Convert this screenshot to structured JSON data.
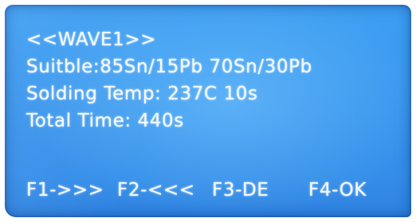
{
  "screen": {
    "title": "<<WAVE1>>",
    "suitable": "Suitble:85Sn/15Pb 70Sn/30Pb",
    "solding_temp": "Solding Temp: 237C 10s",
    "total_time": "Total Time: 440s"
  },
  "softkeys": {
    "f1": "F1->>>",
    "f2": "F2-<<<",
    "f3": "F3-DE",
    "f4": "F4-OK"
  },
  "colors": {
    "lcd_background": "#3a97ee",
    "text": "#f2f8ff"
  }
}
